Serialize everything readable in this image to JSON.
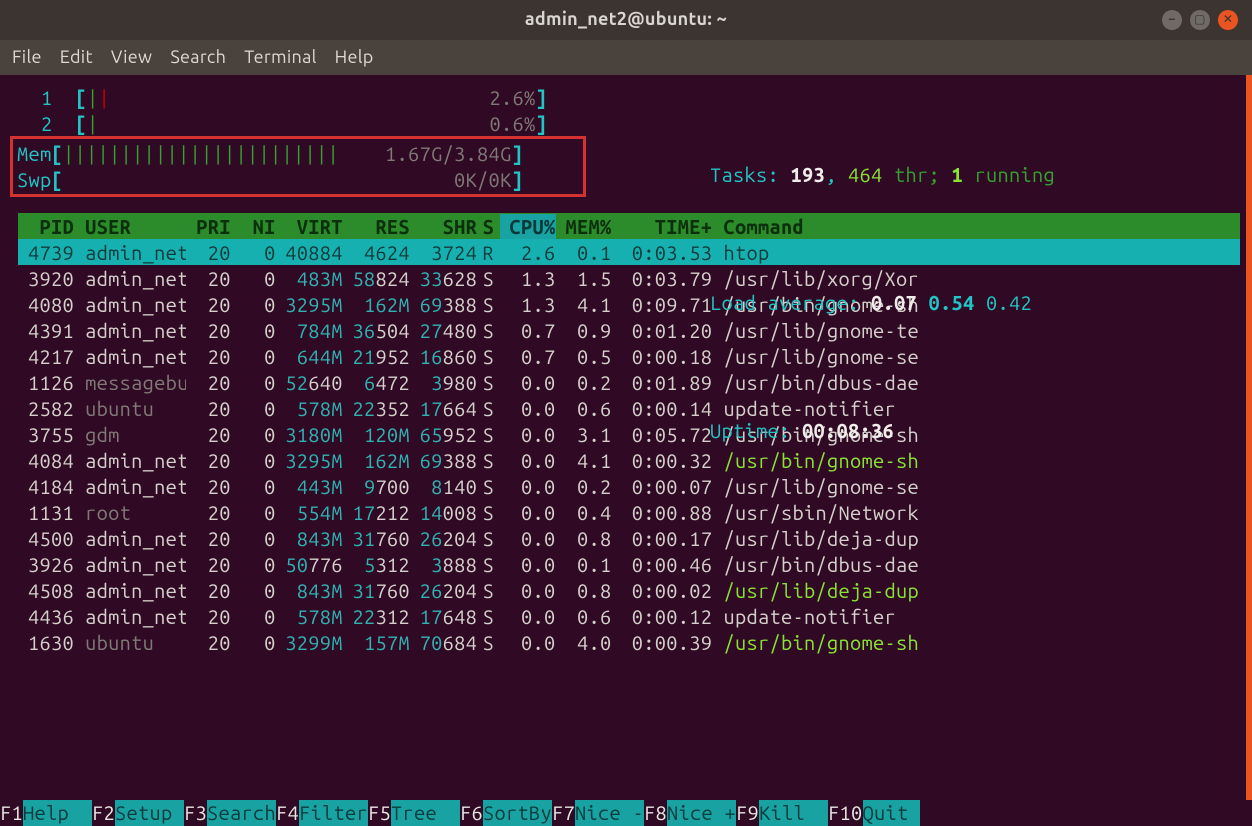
{
  "window": {
    "title": "admin_net2@ubuntu: ~"
  },
  "menu": [
    "File",
    "Edit",
    "View",
    "Search",
    "Terminal",
    "Help"
  ],
  "meters": {
    "cpu": [
      {
        "label": "1",
        "bars": "||",
        "bar_color": "green-red",
        "pct": "2.6%"
      },
      {
        "label": "2",
        "bars": "|",
        "bar_color": "green",
        "pct": "0.6%"
      }
    ],
    "mem": {
      "label": "Mem",
      "bars": "||||||||||||||||||||||||",
      "value": "1.67G/3.84G"
    },
    "swp": {
      "label": "Swp",
      "value": "0K/0K"
    },
    "tasks_label": "Tasks:",
    "tasks_procs": "193",
    "tasks_sep": ",",
    "tasks_threads": "464",
    "tasks_thr_lbl": "thr;",
    "tasks_running": "1",
    "tasks_running_lbl": "running",
    "load_label": "Load average:",
    "load1": "0.07",
    "load5": "0.54",
    "load15": "0.42",
    "uptime_label": "Uptime:",
    "uptime_value": "00:08:36"
  },
  "columns": [
    "PID",
    "USER",
    "PRI",
    "NI",
    "VIRT",
    "RES",
    "SHR",
    "S",
    "CPU%",
    "MEM%",
    "TIME+",
    "Command"
  ],
  "rows": [
    {
      "pid": "4739",
      "user": "admin_net",
      "user_dim": false,
      "pri": "20",
      "ni": "0",
      "virt": "40884",
      "virt_m": false,
      "res": "4624",
      "res_m": false,
      "shr": "3724",
      "shr_m": false,
      "s": "R",
      "cpu": "2.6",
      "mem": "0.1",
      "time": "0:03.53",
      "cmd": "htop",
      "cmd_green": false,
      "selected": true
    },
    {
      "pid": "3920",
      "user": "admin_net",
      "user_dim": false,
      "pri": "20",
      "ni": "0",
      "virt": "483",
      "virt_m": true,
      "res": "58824",
      "res_m": false,
      "res_hi": "58",
      "shr": "33628",
      "shr_m": false,
      "shr_hi": "33",
      "s": "S",
      "cpu": "1.3",
      "mem": "1.5",
      "time": "0:03.79",
      "cmd": "/usr/lib/xorg/Xor",
      "cmd_green": false
    },
    {
      "pid": "4080",
      "user": "admin_net",
      "user_dim": false,
      "pri": "20",
      "ni": "0",
      "virt": "3295",
      "virt_m": true,
      "res": "162",
      "res_m": true,
      "shr": "69388",
      "shr_m": false,
      "shr_hi": "69",
      "s": "S",
      "cpu": "1.3",
      "mem": "4.1",
      "time": "0:09.71",
      "cmd": "/usr/bin/gnome-sh",
      "cmd_green": false
    },
    {
      "pid": "4391",
      "user": "admin_net",
      "user_dim": false,
      "pri": "20",
      "ni": "0",
      "virt": "784",
      "virt_m": true,
      "res": "36504",
      "res_m": false,
      "res_hi": "36",
      "shr": "27480",
      "shr_m": false,
      "shr_hi": "27",
      "s": "S",
      "cpu": "0.7",
      "mem": "0.9",
      "time": "0:01.20",
      "cmd": "/usr/lib/gnome-te",
      "cmd_green": false
    },
    {
      "pid": "4217",
      "user": "admin_net",
      "user_dim": false,
      "pri": "20",
      "ni": "0",
      "virt": "644",
      "virt_m": true,
      "res": "21952",
      "res_m": false,
      "res_hi": "21",
      "shr": "16860",
      "shr_m": false,
      "shr_hi": "16",
      "s": "S",
      "cpu": "0.7",
      "mem": "0.5",
      "time": "0:00.18",
      "cmd": "/usr/lib/gnome-se",
      "cmd_green": false
    },
    {
      "pid": "1126",
      "user": "messagebu",
      "user_dim": true,
      "pri": "20",
      "ni": "0",
      "virt": "52640",
      "virt_m": false,
      "virt_hi": "52",
      "res": "6472",
      "res_m": false,
      "res_hi": "6",
      "shr": "3980",
      "shr_m": false,
      "shr_hi": "3",
      "s": "S",
      "cpu": "0.0",
      "mem": "0.2",
      "time": "0:01.89",
      "cmd": "/usr/bin/dbus-dae",
      "cmd_green": false
    },
    {
      "pid": "2582",
      "user": "ubuntu",
      "user_dim": true,
      "pri": "20",
      "ni": "0",
      "virt": "578",
      "virt_m": true,
      "res": "22352",
      "res_m": false,
      "res_hi": "22",
      "shr": "17664",
      "shr_m": false,
      "shr_hi": "17",
      "s": "S",
      "cpu": "0.0",
      "mem": "0.6",
      "time": "0:00.14",
      "cmd": "update-notifier",
      "cmd_green": false
    },
    {
      "pid": "3755",
      "user": "gdm",
      "user_dim": true,
      "pri": "20",
      "ni": "0",
      "virt": "3180",
      "virt_m": true,
      "res": "120",
      "res_m": true,
      "shr": "65952",
      "shr_m": false,
      "shr_hi": "65",
      "s": "S",
      "cpu": "0.0",
      "mem": "3.1",
      "time": "0:05.72",
      "cmd": "/usr/bin/gnome-sh",
      "cmd_green": false
    },
    {
      "pid": "4084",
      "user": "admin_net",
      "user_dim": false,
      "pri": "20",
      "ni": "0",
      "virt": "3295",
      "virt_m": true,
      "res": "162",
      "res_m": true,
      "shr": "69388",
      "shr_m": false,
      "shr_hi": "69",
      "s": "S",
      "cpu": "0.0",
      "mem": "4.1",
      "time": "0:00.32",
      "cmd": "/usr/bin/gnome-sh",
      "cmd_green": true
    },
    {
      "pid": "4184",
      "user": "admin_net",
      "user_dim": false,
      "pri": "20",
      "ni": "0",
      "virt": "443",
      "virt_m": true,
      "res": "9700",
      "res_m": false,
      "res_hi": "9",
      "shr": "8140",
      "shr_m": false,
      "shr_hi": "8",
      "s": "S",
      "cpu": "0.0",
      "mem": "0.2",
      "time": "0:00.07",
      "cmd": "/usr/lib/gnome-se",
      "cmd_green": false
    },
    {
      "pid": "1131",
      "user": "root",
      "user_dim": true,
      "pri": "20",
      "ni": "0",
      "virt": "554",
      "virt_m": true,
      "res": "17212",
      "res_m": false,
      "res_hi": "17",
      "shr": "14008",
      "shr_m": false,
      "shr_hi": "14",
      "s": "S",
      "cpu": "0.0",
      "mem": "0.4",
      "time": "0:00.88",
      "cmd": "/usr/sbin/Network",
      "cmd_green": false
    },
    {
      "pid": "4500",
      "user": "admin_net",
      "user_dim": false,
      "pri": "20",
      "ni": "0",
      "virt": "843",
      "virt_m": true,
      "res": "31760",
      "res_m": false,
      "res_hi": "31",
      "shr": "26204",
      "shr_m": false,
      "shr_hi": "26",
      "s": "S",
      "cpu": "0.0",
      "mem": "0.8",
      "time": "0:00.17",
      "cmd": "/usr/lib/deja-dup",
      "cmd_green": false
    },
    {
      "pid": "3926",
      "user": "admin_net",
      "user_dim": false,
      "pri": "20",
      "ni": "0",
      "virt": "50776",
      "virt_m": false,
      "virt_hi": "50",
      "res": "5312",
      "res_m": false,
      "res_hi": "5",
      "shr": "3888",
      "shr_m": false,
      "shr_hi": "3",
      "s": "S",
      "cpu": "0.0",
      "mem": "0.1",
      "time": "0:00.46",
      "cmd": "/usr/bin/dbus-dae",
      "cmd_green": false
    },
    {
      "pid": "4508",
      "user": "admin_net",
      "user_dim": false,
      "pri": "20",
      "ni": "0",
      "virt": "843",
      "virt_m": true,
      "res": "31760",
      "res_m": false,
      "res_hi": "31",
      "shr": "26204",
      "shr_m": false,
      "shr_hi": "26",
      "s": "S",
      "cpu": "0.0",
      "mem": "0.8",
      "time": "0:00.02",
      "cmd": "/usr/lib/deja-dup",
      "cmd_green": true
    },
    {
      "pid": "4436",
      "user": "admin_net",
      "user_dim": false,
      "pri": "20",
      "ni": "0",
      "virt": "578",
      "virt_m": true,
      "res": "22312",
      "res_m": false,
      "res_hi": "22",
      "shr": "17648",
      "shr_m": false,
      "shr_hi": "17",
      "s": "S",
      "cpu": "0.0",
      "mem": "0.6",
      "time": "0:00.12",
      "cmd": "update-notifier",
      "cmd_green": false
    },
    {
      "pid": "1630",
      "user": "ubuntu",
      "user_dim": true,
      "pri": "20",
      "ni": "0",
      "virt": "3299",
      "virt_m": true,
      "res": "157",
      "res_m": true,
      "shr": "70684",
      "shr_m": false,
      "shr_hi": "70",
      "s": "S",
      "cpu": "0.0",
      "mem": "4.0",
      "time": "0:00.39",
      "cmd": "/usr/bin/gnome-sh",
      "cmd_green": true
    }
  ],
  "fkeys": [
    {
      "k": "F1",
      "l": "Help  "
    },
    {
      "k": "F2",
      "l": "Setup "
    },
    {
      "k": "F3",
      "l": "Search"
    },
    {
      "k": "F4",
      "l": "Filter"
    },
    {
      "k": "F5",
      "l": "Tree  "
    },
    {
      "k": "F6",
      "l": "SortBy"
    },
    {
      "k": "F7",
      "l": "Nice -"
    },
    {
      "k": "F8",
      "l": "Nice +"
    },
    {
      "k": "F9",
      "l": "Kill  "
    },
    {
      "k": "F10",
      "l": "Quit "
    }
  ]
}
